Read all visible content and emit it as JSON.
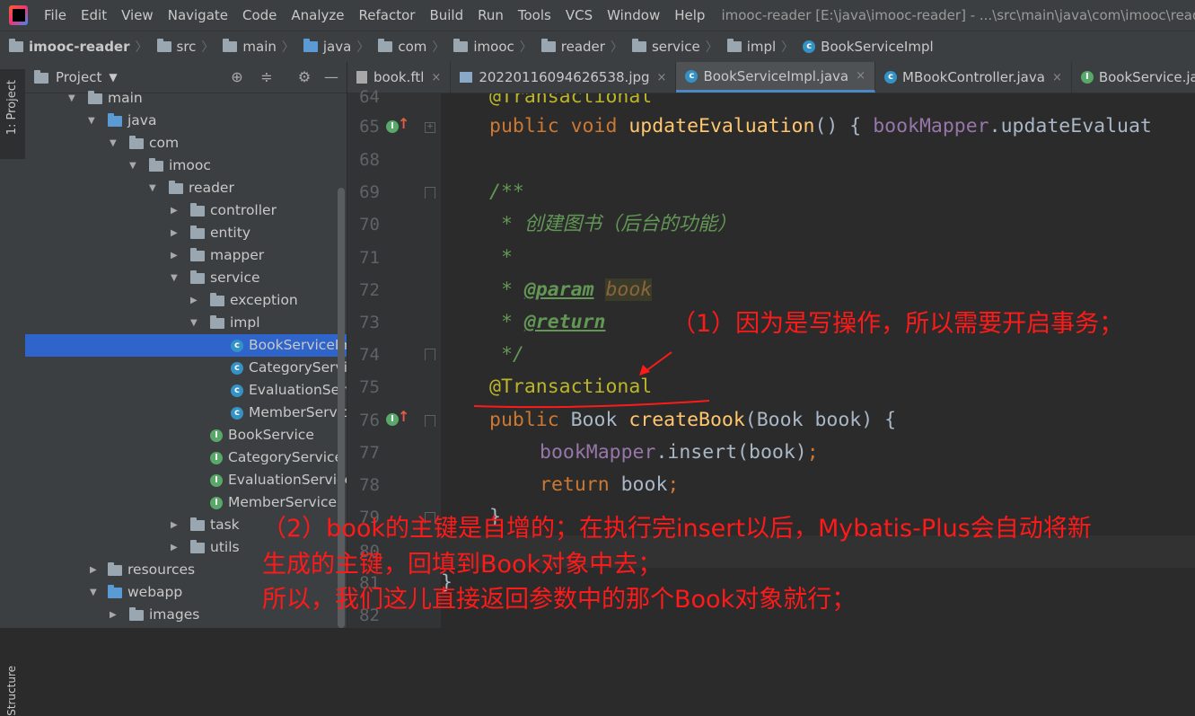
{
  "menubar": {
    "items": [
      "File",
      "Edit",
      "View",
      "Navigate",
      "Code",
      "Analyze",
      "Refactor",
      "Build",
      "Run",
      "Tools",
      "VCS",
      "Window",
      "Help"
    ],
    "window_title": "imooc-reader [E:\\java\\imooc-reader] - ...\\src\\main\\java\\com\\imooc\\reader\\"
  },
  "breadcrumb": [
    "imooc-reader",
    "src",
    "main",
    "java",
    "com",
    "imooc",
    "reader",
    "service",
    "impl",
    "BookServiceImpl"
  ],
  "sidebar": {
    "project_tab": "1: Project",
    "structure_tab": "Structure"
  },
  "project_panel": {
    "title": "Project",
    "tree": [
      {
        "label": "main",
        "kind": "folder"
      },
      {
        "label": "java",
        "kind": "folder-blue"
      },
      {
        "label": "com",
        "kind": "package"
      },
      {
        "label": "imooc",
        "kind": "package"
      },
      {
        "label": "reader",
        "kind": "package"
      },
      {
        "label": "controller",
        "kind": "package"
      },
      {
        "label": "entity",
        "kind": "package"
      },
      {
        "label": "mapper",
        "kind": "package"
      },
      {
        "label": "service",
        "kind": "package"
      },
      {
        "label": "exception",
        "kind": "package"
      },
      {
        "label": "impl",
        "kind": "package"
      },
      {
        "label": "BookServiceImpl",
        "kind": "class"
      },
      {
        "label": "CategoryServiceImpl",
        "kind": "class"
      },
      {
        "label": "EvaluationServiceImpl",
        "kind": "class"
      },
      {
        "label": "MemberServiceImpl",
        "kind": "class"
      },
      {
        "label": "BookService",
        "kind": "interface"
      },
      {
        "label": "CategoryService",
        "kind": "interface"
      },
      {
        "label": "EvaluationService",
        "kind": "interface"
      },
      {
        "label": "MemberService",
        "kind": "interface"
      },
      {
        "label": "task",
        "kind": "package"
      },
      {
        "label": "utils",
        "kind": "package"
      },
      {
        "label": "resources",
        "kind": "folder"
      },
      {
        "label": "webapp",
        "kind": "folder"
      },
      {
        "label": "images",
        "kind": "folder"
      }
    ]
  },
  "editor_tabs": [
    {
      "label": "book.ftl",
      "icon": "file-icon"
    },
    {
      "label": "20220116094626538.jpg",
      "icon": "image-icon"
    },
    {
      "label": "BookServiceImpl.java",
      "icon": "class-icon"
    },
    {
      "label": "MBookController.java",
      "icon": "class-icon"
    },
    {
      "label": "BookService.java",
      "icon": "interface-icon"
    }
  ],
  "code": {
    "line_numbers": [
      "64",
      "65",
      "68",
      "69",
      "70",
      "71",
      "72",
      "73",
      "74",
      "75",
      "76",
      "77",
      "78",
      "79",
      "80",
      "81",
      "82"
    ],
    "l64_ann": "@Transactional",
    "l65_kw": "public void ",
    "l65_fn": "updateEvaluation",
    "l65_rest": "() { ",
    "l65_fld": "bookMapper",
    "l65_tail": ".updateEvaluat",
    "l69": "/**",
    "l70": " * 创建图书（后台的功能）",
    "l71": " *",
    "l72_star": " * ",
    "l72_tag": "@param",
    "l72_param": "book",
    "l73_star": " * ",
    "l73_tag": "@return",
    "l74": " */",
    "l75": "@Transactional",
    "l76_kw": "public ",
    "l76_type": "Book ",
    "l76_fn": "createBook",
    "l76_rest": "(Book book) {",
    "l77_fld": "bookMapper",
    "l77_rest": ".insert(book)",
    "l77_semi": ";",
    "l78_kw": "return ",
    "l78_rest": "book",
    "l78_semi": ";",
    "l79": "}",
    "l81": "}"
  },
  "annotations": {
    "note1": "（1）因为是写操作，所以需要开启事务；",
    "note2_line1": "（2）book的主键是自增的；在执行完insert以后，Mybatis-Plus会自动将新",
    "note2_line2": "生成的主键，回填到Book对象中去；",
    "note2_line3": "所以，我们这儿直接返回参数中的那个Book对象就行；",
    "color": "#ff1a1a"
  }
}
